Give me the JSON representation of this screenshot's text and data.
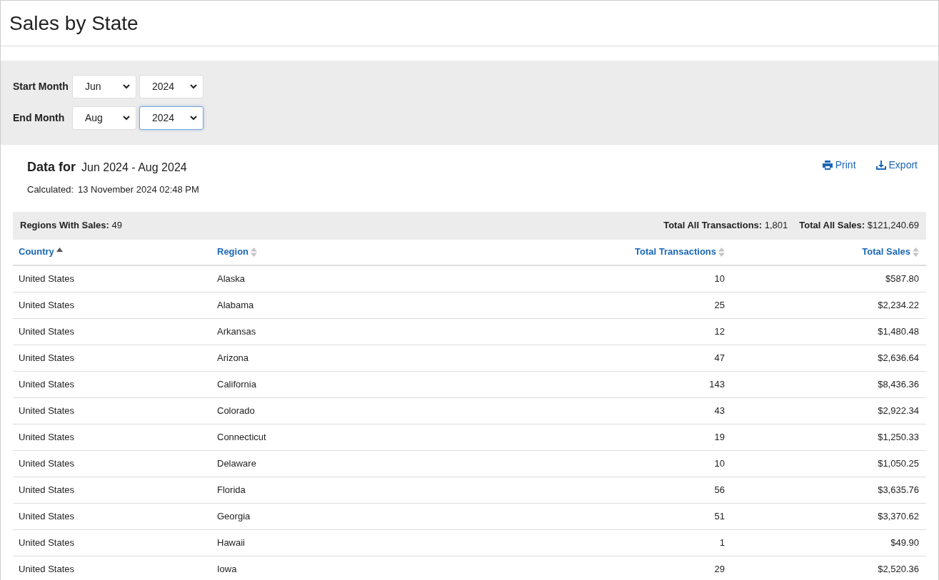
{
  "page_title": "Sales by State",
  "filters": [
    {
      "label": "Start Month",
      "month": {
        "value": "Jun",
        "focused": false
      },
      "year": {
        "value": "2024",
        "focused": false
      }
    },
    {
      "label": "End Month",
      "month": {
        "value": "Aug",
        "focused": false
      },
      "year": {
        "value": "2024",
        "focused": true
      }
    }
  ],
  "summary": {
    "heading": "Data for",
    "range": "Jun 2024 - Aug 2024",
    "calculated_label": "Calculated:",
    "calculated_value": "13 November 2024 02:48 PM"
  },
  "actions": [
    {
      "kind": "print",
      "label": "Print"
    },
    {
      "kind": "export",
      "label": "Export"
    }
  ],
  "totals": {
    "regions_label": "Regions With Sales:",
    "regions_value": "49",
    "transactions_label": "Total All Transactions:",
    "transactions_value": "1,801",
    "sales_label": "Total All Sales:",
    "sales_value": "$121,240.69"
  },
  "table": {
    "columns": [
      {
        "label": "Country",
        "sorted": true,
        "kind": "text"
      },
      {
        "label": "Region",
        "sorted": false,
        "kind": "text"
      },
      {
        "label": "Total Transactions",
        "sorted": false,
        "kind": "number"
      },
      {
        "label": "Total Sales",
        "sorted": false,
        "kind": "number"
      }
    ],
    "rows": [
      [
        "United States",
        "Alaska",
        "10",
        "$587.80"
      ],
      [
        "United States",
        "Alabama",
        "25",
        "$2,234.22"
      ],
      [
        "United States",
        "Arkansas",
        "12",
        "$1,480.48"
      ],
      [
        "United States",
        "Arizona",
        "47",
        "$2,636.64"
      ],
      [
        "United States",
        "California",
        "143",
        "$8,436.36"
      ],
      [
        "United States",
        "Colorado",
        "43",
        "$2,922.34"
      ],
      [
        "United States",
        "Connecticut",
        "19",
        "$1,250.33"
      ],
      [
        "United States",
        "Delaware",
        "10",
        "$1,050.25"
      ],
      [
        "United States",
        "Florida",
        "56",
        "$3,635.76"
      ],
      [
        "United States",
        "Georgia",
        "51",
        "$3,370.62"
      ],
      [
        "United States",
        "Hawaii",
        "1",
        "$49.90"
      ],
      [
        "United States",
        "Iowa",
        "29",
        "$2,520.36"
      ]
    ]
  }
}
